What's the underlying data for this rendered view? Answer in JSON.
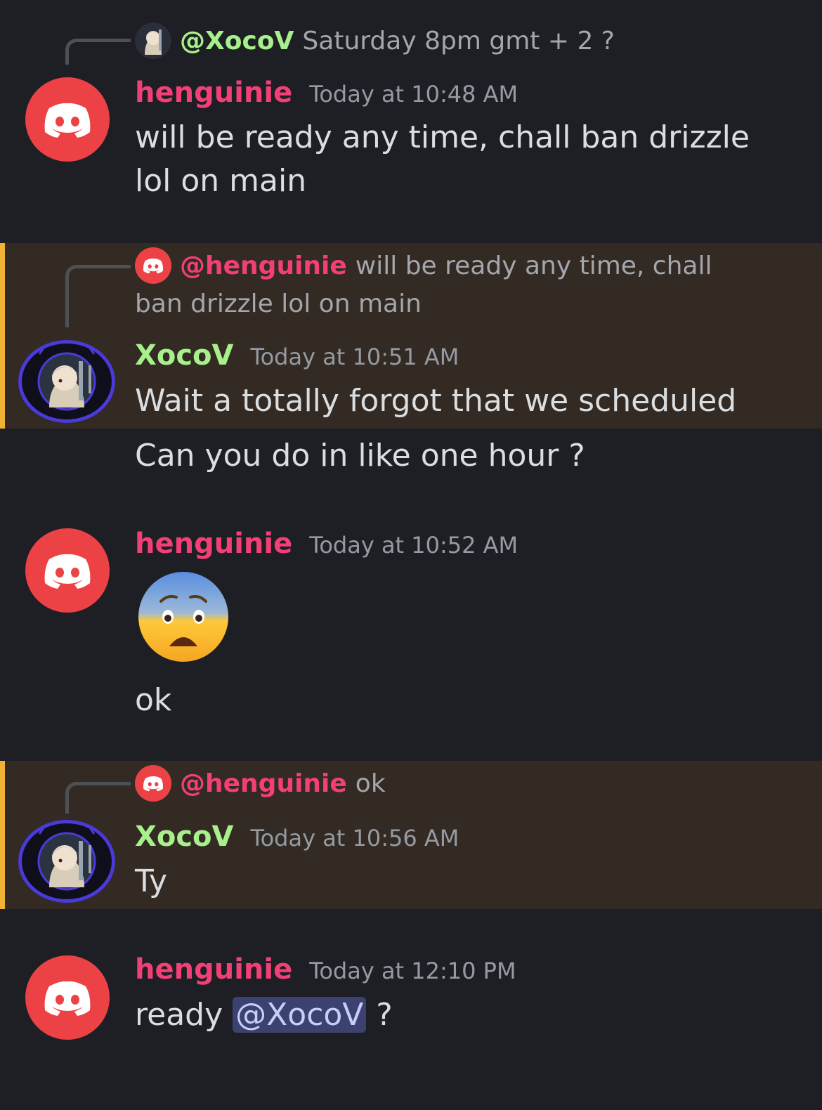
{
  "messages": [
    {
      "reply": {
        "user": "@XocoV",
        "text": "Saturday 8pm gmt + 2 ?"
      },
      "author": "henguinie",
      "time": "Today at 10:48 AM",
      "text": "will be ready any time, chall ban drizzle lol on main"
    },
    {
      "reply": {
        "user": "@henguinie",
        "text": "will be ready any time, chall ban drizzle lol on main"
      },
      "author": "XocoV",
      "time": "Today at 10:51 AM",
      "text": "Wait a totally forgot that we scheduled",
      "followup": "Can you do in like one hour ?"
    },
    {
      "author": "henguinie",
      "time": "Today at 10:52 AM",
      "emoji": "fearful-face-emoji",
      "text": "ok"
    },
    {
      "reply": {
        "user": "@henguinie",
        "text": "ok"
      },
      "author": "XocoV",
      "time": "Today at 10:56 AM",
      "text": "Ty"
    },
    {
      "author": "henguinie",
      "time": "Today at 12:10 PM",
      "text_before": "ready",
      "mention": "@XocoV",
      "text_after": "?"
    }
  ],
  "colors": {
    "background": "#1e1f24",
    "highlight_background": "#332a23",
    "highlight_bar": "#f0b232",
    "henguinie_name": "#f23f75",
    "xocov_name": "#a7f08b",
    "discord_avatar": "#ed4245",
    "mention_pill": "#3c4270"
  }
}
